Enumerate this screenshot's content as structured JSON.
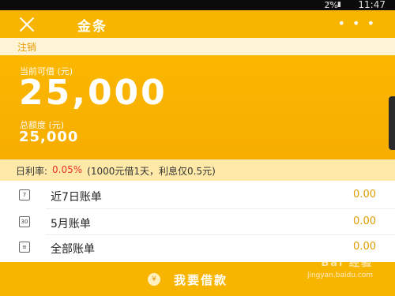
{
  "status": {
    "battery": "2%",
    "time": "11:47"
  },
  "header": {
    "title": "金条"
  },
  "notice": {
    "text": "注销"
  },
  "credit": {
    "available_label": "当前可借 (元)",
    "available_amount": "25,000",
    "total_label": "总额度 (元)",
    "total_amount": "25,000"
  },
  "rate": {
    "label": "日利率:",
    "value": "0.05%",
    "note": "(1000元借1天，利息仅0.5元)"
  },
  "bills": [
    {
      "icon": "7",
      "name": "近7日账单",
      "amount": "0.00"
    },
    {
      "icon": "30",
      "name": "5月账单",
      "amount": "0.00"
    },
    {
      "icon": "≡",
      "name": "全部账单",
      "amount": "0.00"
    }
  ],
  "action": {
    "icon": "¥",
    "label": "我要借款"
  },
  "watermark": {
    "logo": "Bai 经验",
    "url": "jingyan.baidu.com"
  }
}
